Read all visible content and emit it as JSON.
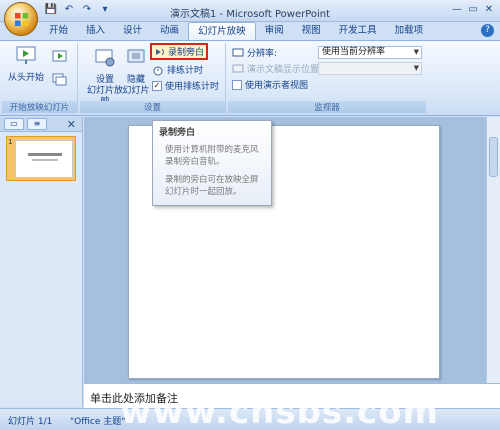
{
  "window": {
    "title": "演示文稿1 - Microsoft PowerPoint"
  },
  "tabs": [
    {
      "label": "开始"
    },
    {
      "label": "插入"
    },
    {
      "label": "设计"
    },
    {
      "label": "动画"
    },
    {
      "label": "幻灯片放映"
    },
    {
      "label": "审阅"
    },
    {
      "label": "视图"
    },
    {
      "label": "开发工具"
    },
    {
      "label": "加载项"
    }
  ],
  "ribbon": {
    "start_group": {
      "label": "开始放映幻灯片",
      "from_start": "从头开始"
    },
    "setup_group": {
      "label": "设置",
      "setup_show": "设置\n幻灯片放映",
      "hide_slide": "隐藏\n幻灯片",
      "record_narration": "录制旁白",
      "rehearse_timings": "排练计时",
      "use_timings": "使用排练计时"
    },
    "monitor_group": {
      "label": "监视器",
      "resolution_label": "分辨率:",
      "resolution_value": "使用当前分辨率",
      "show_on_label": "演示文稿显示位置:",
      "presenter_view": "使用演示者视图"
    }
  },
  "tooltip": {
    "title": "录制旁白",
    "para1": "使用计算机附带的麦克风录制旁白音轨。",
    "para2": "录制的旁白可在放映全屏幻灯片时一起回放。"
  },
  "slides_pane": {
    "slide_number": "1"
  },
  "notes": {
    "placeholder": "单击此处添加备注"
  },
  "status": {
    "slide_count": "幻灯片 1/1",
    "theme": "\"Office 主题\""
  },
  "watermark": {
    "text": "www.chsbs.com"
  }
}
